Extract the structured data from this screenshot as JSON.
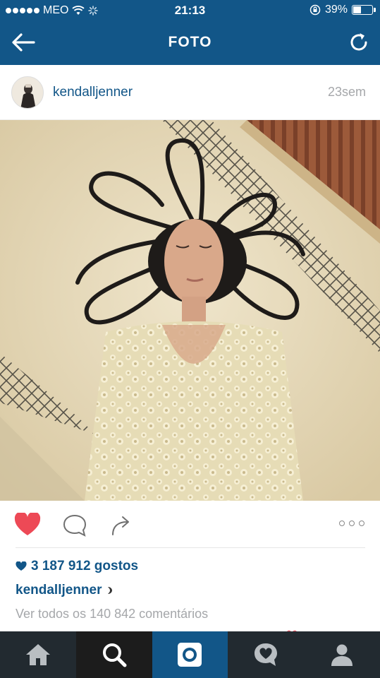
{
  "status_bar": {
    "carrier": "MEO",
    "time": "21:13",
    "battery_percent": "39%",
    "battery_level": 0.39
  },
  "nav": {
    "title": "FOTO"
  },
  "post": {
    "username": "kendalljenner",
    "time_ago": "23sem",
    "likes": "3 187 912 gostos",
    "caption_user": "kendalljenner",
    "view_comments": "Ver todos os 140 842 comentários"
  },
  "colors": {
    "brand": "#125688",
    "like": "#ed4956",
    "tabbar": "#222a30"
  },
  "icons": {
    "back": "arrow-left-icon",
    "refresh": "refresh-icon",
    "like": "heart-icon",
    "comment": "comment-bubble-icon",
    "share": "share-arrow-icon",
    "more": "more-dots-icon",
    "home": "home-icon",
    "search": "search-icon",
    "camera": "camera-icon",
    "activity": "heart-bubble-icon",
    "profile": "profile-icon"
  }
}
